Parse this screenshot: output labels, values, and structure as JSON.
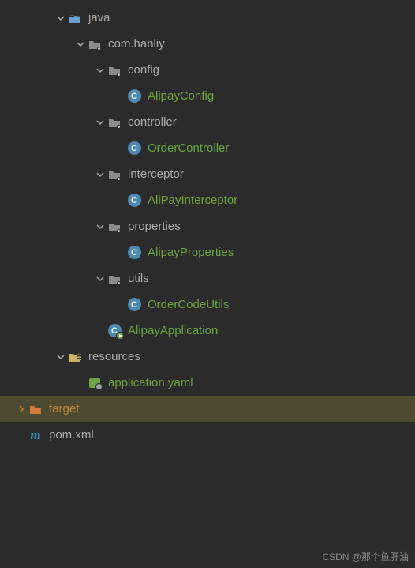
{
  "tree": {
    "java": "java",
    "com_hanliy": "com.hanliy",
    "config": "config",
    "AlipayConfig": "AlipayConfig",
    "controller": "controller",
    "OrderController": "OrderController",
    "interceptor": "interceptor",
    "AliPayInterceptor": "AliPayInterceptor",
    "properties": "properties",
    "AlipayProperties": "AlipayProperties",
    "utils": "utils",
    "OrderCodeUtils": "OrderCodeUtils",
    "AlipayApplication": "AlipayApplication",
    "resources": "resources",
    "application_yaml": "application.yaml",
    "target": "target",
    "pom_xml": "pom.xml"
  },
  "watermark": "CSDN @那个鱼肝油"
}
